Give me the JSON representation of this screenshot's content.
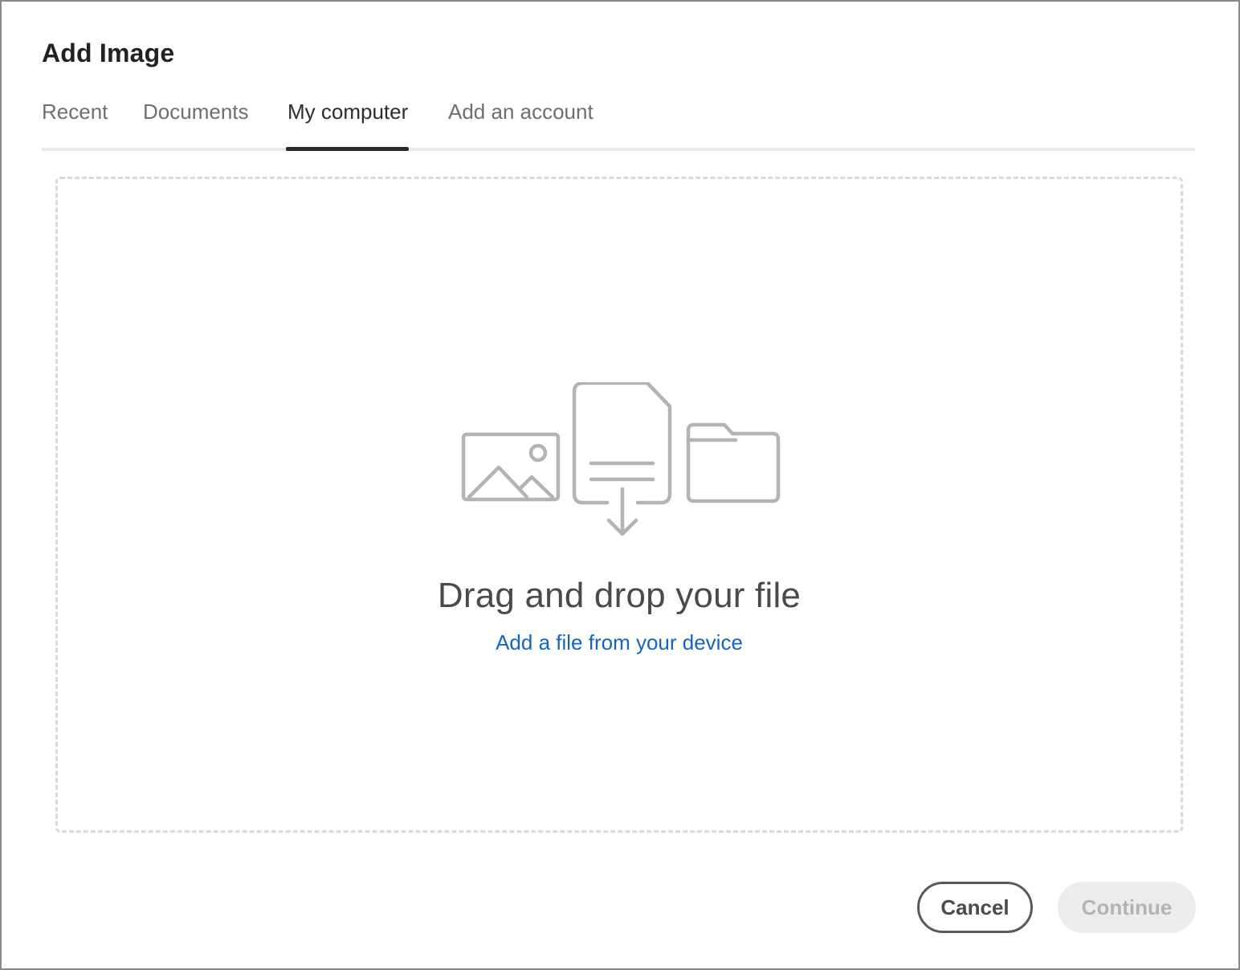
{
  "dialog": {
    "title": "Add Image"
  },
  "tabs": [
    {
      "label": "Recent",
      "active": false
    },
    {
      "label": "Documents",
      "active": false
    },
    {
      "label": "My computer",
      "active": true
    },
    {
      "label": "Add an account",
      "active": false
    }
  ],
  "dropzone": {
    "heading": "Drag and drop your file",
    "link_label": "Add a file from your device",
    "icons": [
      "image-icon",
      "document-download-icon",
      "folder-icon"
    ]
  },
  "footer": {
    "cancel_label": "Cancel",
    "continue_label": "Continue",
    "continue_enabled": false
  },
  "colors": {
    "link": "#1264c8",
    "active_tab": "#2c2c2c",
    "inactive_tab": "#6e6e6e",
    "illustration": "#b3b3b3",
    "disabled_button_bg": "#ececec"
  }
}
